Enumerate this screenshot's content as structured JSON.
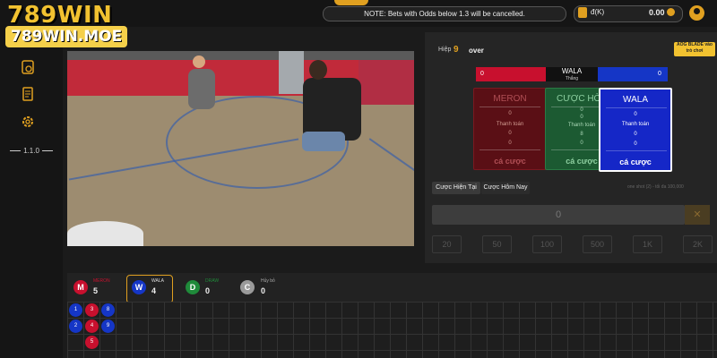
{
  "brand": {
    "logo_text": "789WIN",
    "domain_text": "789WIN.MOE"
  },
  "topbar": {
    "notice": "NOTE: Bets with Odds below 1.3 will be cancelled.",
    "balance_unit": "đ(K)",
    "balance_value": "0.00",
    "accent_color": "#e0a020"
  },
  "sidebar": {
    "items": [
      {
        "icon": "wallet-icon"
      },
      {
        "icon": "document-icon"
      },
      {
        "icon": "gear-icon"
      }
    ],
    "version": "1.1.0"
  },
  "round": {
    "label": "Hiệp",
    "number": "9",
    "status": "over",
    "aog_label": "AOG BLADE vào trò chơi"
  },
  "result_bar": {
    "meron_value": "0",
    "winner": "WALA",
    "winner_sub": "Thắng",
    "wala_value": "0"
  },
  "bet_cards": {
    "meron": {
      "title": "MERON",
      "v1": "0",
      "payout_label": "Thanh toán",
      "v2": "0",
      "v3": "0",
      "footer": "cá cược"
    },
    "draw": {
      "title": "CƯỢC HÒA",
      "v1": "0",
      "v2": "0",
      "payout_label": "Thanh toán",
      "v3": "8",
      "v4": "0",
      "footer": "cá cược"
    },
    "wala": {
      "title": "WALA",
      "v1": "0",
      "payout_label": "Thanh toán",
      "v2": "0",
      "v3": "0",
      "footer": "cá cược"
    }
  },
  "tabs": {
    "current": "Cược Hiện Tại",
    "today": "Cược Hôm Nay"
  },
  "bet_limits": "one shot (2) - tối đa 100,000",
  "amount": {
    "value": "0",
    "clear": "✕"
  },
  "chips": [
    "20",
    "50",
    "100",
    "500",
    "1K",
    "2K"
  ],
  "stats": {
    "meron": {
      "letter": "M",
      "label": "MERON",
      "count": "5"
    },
    "wala": {
      "letter": "W",
      "label": "WALA",
      "count": "4"
    },
    "draw": {
      "letter": "D",
      "label": "DRAW",
      "count": "0"
    },
    "cancel": {
      "letter": "C",
      "label": "Hủy bỏ",
      "count": "0"
    }
  },
  "results": [
    {
      "n": "1",
      "side": "wala"
    },
    {
      "n": "2",
      "side": "wala"
    },
    {
      "n": "3",
      "side": "meron"
    },
    {
      "n": "4",
      "side": "meron"
    },
    {
      "n": "5",
      "side": "meron"
    },
    {
      "n": "6",
      "side": "meron"
    },
    {
      "n": "7",
      "side": "meron"
    },
    {
      "n": "8",
      "side": "wala"
    },
    {
      "n": "9",
      "side": "wala"
    }
  ]
}
